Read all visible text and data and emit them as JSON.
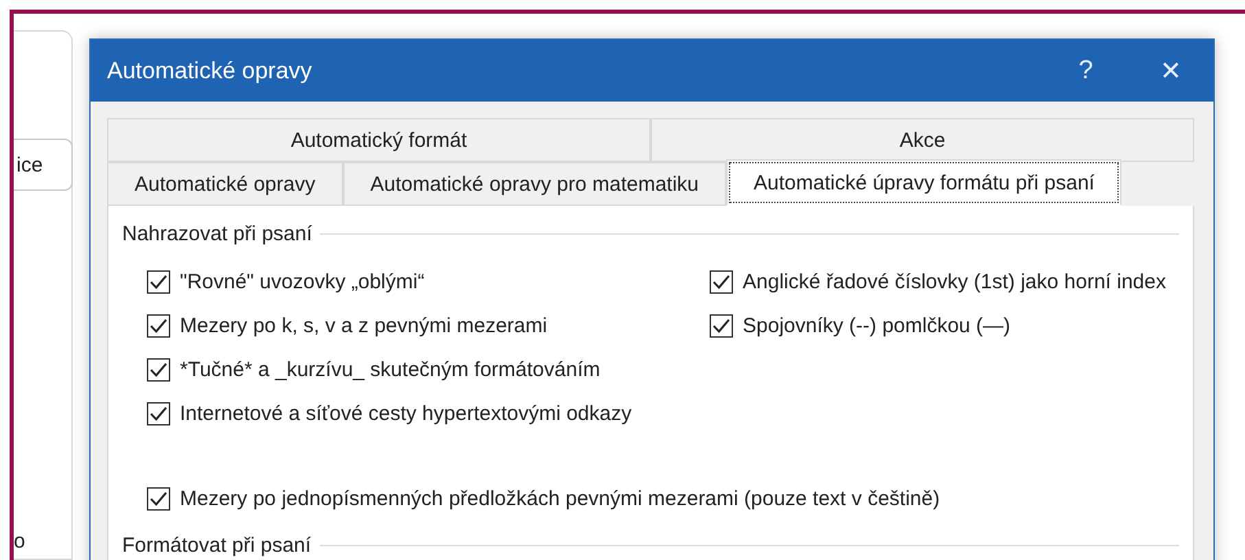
{
  "background": {
    "button": "ice",
    "label": "o"
  },
  "dialog": {
    "title": "Automatické opravy",
    "help": "?",
    "close": "✕",
    "tab_rows": [
      [
        {
          "label": "Automatický formát",
          "selected": false
        },
        {
          "label": "Akce",
          "selected": false
        }
      ],
      [
        {
          "label": "Automatické opravy",
          "selected": false
        },
        {
          "label": "Automatické opravy pro matematiku",
          "selected": false
        },
        {
          "label": "Automatické úpravy formátu při psaní",
          "selected": true
        }
      ]
    ],
    "groups": [
      {
        "title": "Nahrazovat při psaní",
        "columns": [
          [
            {
              "label": "\"Rovné\" uvozovky „oblými“",
              "checked": true
            },
            {
              "label": "Mezery po k, s, v a z pevnými mezerami",
              "checked": true
            },
            {
              "label": "*Tučné* a _kurzívu_ skutečným formátováním",
              "checked": true
            },
            {
              "label": "Internetové a síťové cesty hypertextovými odkazy",
              "checked": true
            }
          ],
          [
            {
              "label": "Anglické řadové číslovky (1st) jako horní index",
              "checked": true
            },
            {
              "label": "Spojovníky (--) pomlčkou (—)",
              "checked": true
            }
          ]
        ],
        "extra": [
          {
            "label": "Mezery po jednopísmenných předložkách pevnými mezerami (pouze text v češtině)",
            "checked": true
          }
        ]
      },
      {
        "title": "Formátovat při psaní"
      }
    ]
  }
}
